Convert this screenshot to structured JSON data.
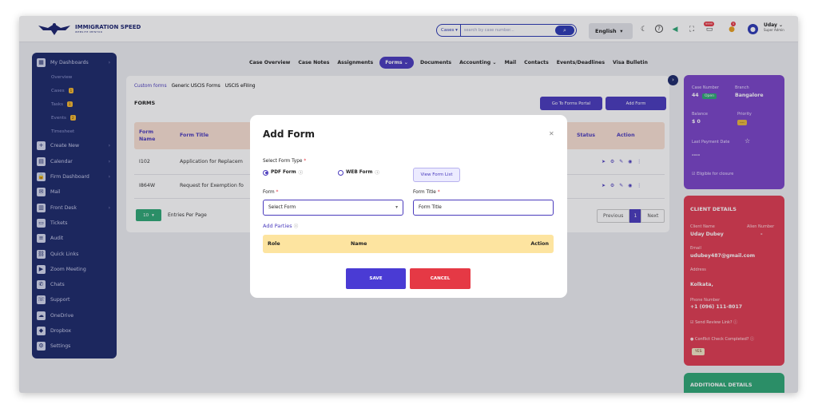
{
  "brand": {
    "name": "IMMIGRATION SPEED",
    "tagline": "WEBSITE MENTOR"
  },
  "search": {
    "type": "Cases",
    "placeholder": "search by case number..."
  },
  "header": {
    "language": "English",
    "notif_badge": "9999",
    "alert_badge": "5",
    "user_name": "Uday",
    "user_role": "Super Admin"
  },
  "sidebar": {
    "items": [
      {
        "kind": "main",
        "label": "My Dashboards",
        "icon": "dashboard-icon",
        "chev": true
      },
      {
        "kind": "sub",
        "label": "Overview"
      },
      {
        "kind": "sub",
        "label": "Cases",
        "count": "1"
      },
      {
        "kind": "sub",
        "label": "Tasks",
        "count": "1"
      },
      {
        "kind": "sub",
        "label": "Events",
        "count": "2"
      },
      {
        "kind": "sub",
        "label": "Timesheet"
      },
      {
        "kind": "main",
        "label": "Create New",
        "icon": "plus-icon",
        "chev": true
      },
      {
        "kind": "main",
        "label": "Calendar",
        "icon": "calendar-icon",
        "chev": true
      },
      {
        "kind": "main",
        "label": "Firm Dashboard",
        "icon": "lock-icon",
        "chev": true
      },
      {
        "kind": "main",
        "label": "Mail",
        "icon": "mail-icon"
      },
      {
        "kind": "main",
        "label": "Front Desk",
        "icon": "desk-icon",
        "chev": true
      },
      {
        "kind": "main",
        "label": "Tickets",
        "icon": "ticket-icon"
      },
      {
        "kind": "main",
        "label": "Audit",
        "icon": "audit-icon"
      },
      {
        "kind": "main",
        "label": "Quick Links",
        "icon": "link-icon"
      },
      {
        "kind": "main",
        "label": "Zoom Meeting",
        "icon": "video-icon"
      },
      {
        "kind": "main",
        "label": "Chats",
        "icon": "chat-icon"
      },
      {
        "kind": "main",
        "label": "Support",
        "icon": "support-icon"
      },
      {
        "kind": "main",
        "label": "OneDrive",
        "icon": "cloud-icon"
      },
      {
        "kind": "main",
        "label": "Dropbox",
        "icon": "dropbox-icon"
      },
      {
        "kind": "main",
        "label": "Settings",
        "icon": "gear-icon"
      }
    ]
  },
  "tabs": [
    "Case Overview",
    "Case Notes",
    "Assignments",
    "Forms",
    "Documents",
    "Accounting",
    "Mail",
    "Contacts",
    "Events/Deadlines",
    "Visa Bulletin"
  ],
  "active_tab": "Forms",
  "forms": {
    "subtabs": [
      "Custom forms",
      "Generic USCIS Forms",
      "USCIS eFiling"
    ],
    "title": "FORMS",
    "portal_button": "Go To Forms Portal",
    "add_button": "Add Form",
    "columns": {
      "form_name": "Form Name",
      "form_title": "Form Title",
      "status": "Status",
      "action": "Action"
    },
    "rows": [
      {
        "name": "I102",
        "title": "Application for Replacem"
      },
      {
        "name": "I864W",
        "title": "Request for Exemption fo"
      }
    ],
    "per_page": "10",
    "per_page_label": "Entries Per Page",
    "prev": "Previous",
    "page": "1",
    "next": "Next"
  },
  "case_panel": {
    "case_number_label": "Case Number",
    "case_number": "44",
    "status": "Open",
    "branch_label": "Branch",
    "branch": "Bangalore",
    "balance_label": "Balance",
    "balance": "$ 0",
    "priority_label": "Priority",
    "priority": "----",
    "last_payment_label": "Last Payment Date",
    "last_payment": "----",
    "closure": "Eligible for closure"
  },
  "client": {
    "title": "CLIENT DETAILS",
    "name_label": "Client Name",
    "alien_label": "Alien Number",
    "name": "Uday Dubey",
    "alien": "-",
    "email_label": "Email",
    "email": "udubey487@gmail.com",
    "address_label": "Address",
    "address": "Kolkata,",
    "phone_label": "Phone Number",
    "phone": "+1 (096) 111-8017",
    "review": "Send Review Link?",
    "conflict": "Conflict Check Completed?",
    "conflict_value": "YES"
  },
  "additional": {
    "title": "ADDITIONAL DETAILS"
  },
  "modal": {
    "title": "Add Form",
    "form_type_label": "Select Form Type",
    "pdf_label": "PDF Form",
    "web_label": "WEB Form",
    "view_list": "View Form List",
    "form_label": "Form",
    "form_value": "Select Form",
    "title_label": "Form Title",
    "title_value": "Form Title",
    "add_parties": "Add Parties",
    "parties_cols": {
      "role": "Role",
      "name": "Name",
      "action": "Action"
    },
    "save": "SAVE",
    "cancel": "CANCEL"
  },
  "colors": {
    "primary": "#4a3bbd",
    "sidebar": "#1d2a6b",
    "client_panel": "#e03c52",
    "case_panel": "#7b45c9",
    "additional_panel": "#2fa876"
  }
}
